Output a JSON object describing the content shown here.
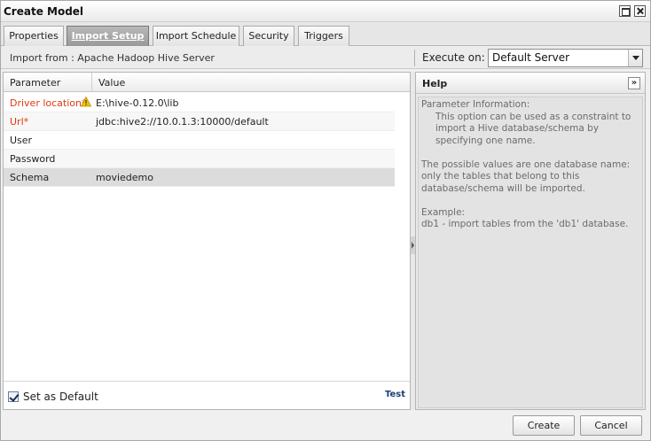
{
  "window": {
    "title": "Create Model"
  },
  "tabs": [
    {
      "label": "Properties",
      "active": false
    },
    {
      "label": "Import Setup",
      "active": true
    },
    {
      "label": "Import Schedule",
      "active": false
    },
    {
      "label": "Security",
      "active": false
    },
    {
      "label": "Triggers",
      "active": false
    }
  ],
  "subbar": {
    "import_from": "Import from : Apache Hadoop Hive Server",
    "execute_label": "Execute on:",
    "execute_value": "Default Server"
  },
  "grid": {
    "headers": {
      "parameter": "Parameter",
      "value": "Value"
    },
    "rows": [
      {
        "parameter": "Driver location*",
        "value": "E:\\hive-0.12.0\\lib",
        "required": true,
        "warning": true
      },
      {
        "parameter": "Url*",
        "value": "jdbc:hive2://10.0.1.3:10000/default",
        "required": true,
        "warning": false
      },
      {
        "parameter": "User",
        "value": "",
        "required": false,
        "warning": false
      },
      {
        "parameter": "Password",
        "value": "",
        "required": false,
        "warning": false
      },
      {
        "parameter": "Schema",
        "value": "moviedemo",
        "required": false,
        "warning": false,
        "selected": true
      }
    ]
  },
  "footer": {
    "set_default_label": "Set as Default",
    "set_default_checked": true,
    "test_label": "Test"
  },
  "help": {
    "title": "Help",
    "collapse_glyph": "»",
    "heading": "Parameter Information:",
    "para1": "This option can be used as a constraint to import a Hive database/schema by specifying one name.",
    "para2": "The possible values are one database name: only the tables that belong to this database/schema will be imported.",
    "example_label": "Example:",
    "example_text": "db1 - import tables from the 'db1' database."
  },
  "buttons": {
    "create": "Create",
    "cancel": "Cancel"
  },
  "colors": {
    "required_label": "#e03a10",
    "link": "#1d3f7a",
    "active_tab": "#a8a8a8",
    "selected_row": "#dcdcdc"
  }
}
